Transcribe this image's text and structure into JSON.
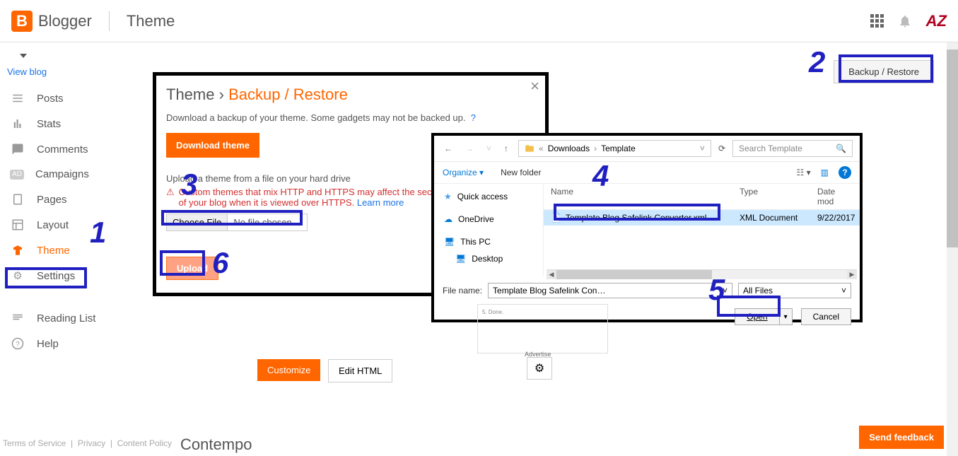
{
  "header": {
    "logo_letter": "B",
    "logo_text": "Blogger",
    "page_title": "Theme",
    "user_initials": "AZ"
  },
  "sidebar": {
    "view_blog": "View blog",
    "items": [
      {
        "label": "Posts"
      },
      {
        "label": "Stats"
      },
      {
        "label": "Comments"
      },
      {
        "label": "Campaigns"
      },
      {
        "label": "Pages"
      },
      {
        "label": "Layout"
      },
      {
        "label": "Theme"
      },
      {
        "label": "Settings"
      },
      {
        "label": "Reading List"
      },
      {
        "label": "Help"
      }
    ]
  },
  "main": {
    "backup_restore_label": "Backup / Restore",
    "customize_label": "Customize",
    "edit_html_label": "Edit HTML",
    "theme_name": "Contempo",
    "preview_done": "5. Done.",
    "preview_advertise": "Advertise"
  },
  "modal": {
    "breadcrumb_root": "Theme",
    "breadcrumb_sep": "›",
    "breadcrumb_leaf": "Backup / Restore",
    "description": "Download a backup of your theme. Some gadgets may not be backed up.",
    "help_mark": "?",
    "download_label": "Download theme",
    "upload_intro": "Upload a theme from a file on your hard drive",
    "warning_text": "Custom themes that mix HTTP and HTTPS may affect the security and user experience of your blog when it is viewed over HTTPS.",
    "learn_more": "Learn more",
    "choose_file_label": "Choose File",
    "no_file_label": "No file chosen",
    "upload_label": "Upload",
    "close_glyph": "×"
  },
  "file_dialog": {
    "path": {
      "p1": "Downloads",
      "p2": "Template"
    },
    "search_placeholder": "Search Template",
    "organize_label": "Organize",
    "new_folder_label": "New folder",
    "tree": {
      "quick_access": "Quick access",
      "onedrive": "OneDrive",
      "this_pc": "This PC",
      "desktop": "Desktop"
    },
    "columns": {
      "name": "Name",
      "type": "Type",
      "date": "Date mod"
    },
    "file": {
      "name": "Template Blog Safelink Converter.xml",
      "type": "XML Document",
      "date": "9/22/2017"
    },
    "filename_label": "File name:",
    "filename_value": "Template Blog Safelink Converter.xml",
    "filetype_value": "All Files",
    "open_label": "Open",
    "cancel_label": "Cancel"
  },
  "annotations": {
    "n1": "1",
    "n2": "2",
    "n3": "3",
    "n4": "4",
    "n5": "5",
    "n6": "6"
  },
  "footer": {
    "terms": "Terms of Service",
    "privacy": "Privacy",
    "content_policy": "Content Policy",
    "send_feedback": "Send feedback"
  }
}
